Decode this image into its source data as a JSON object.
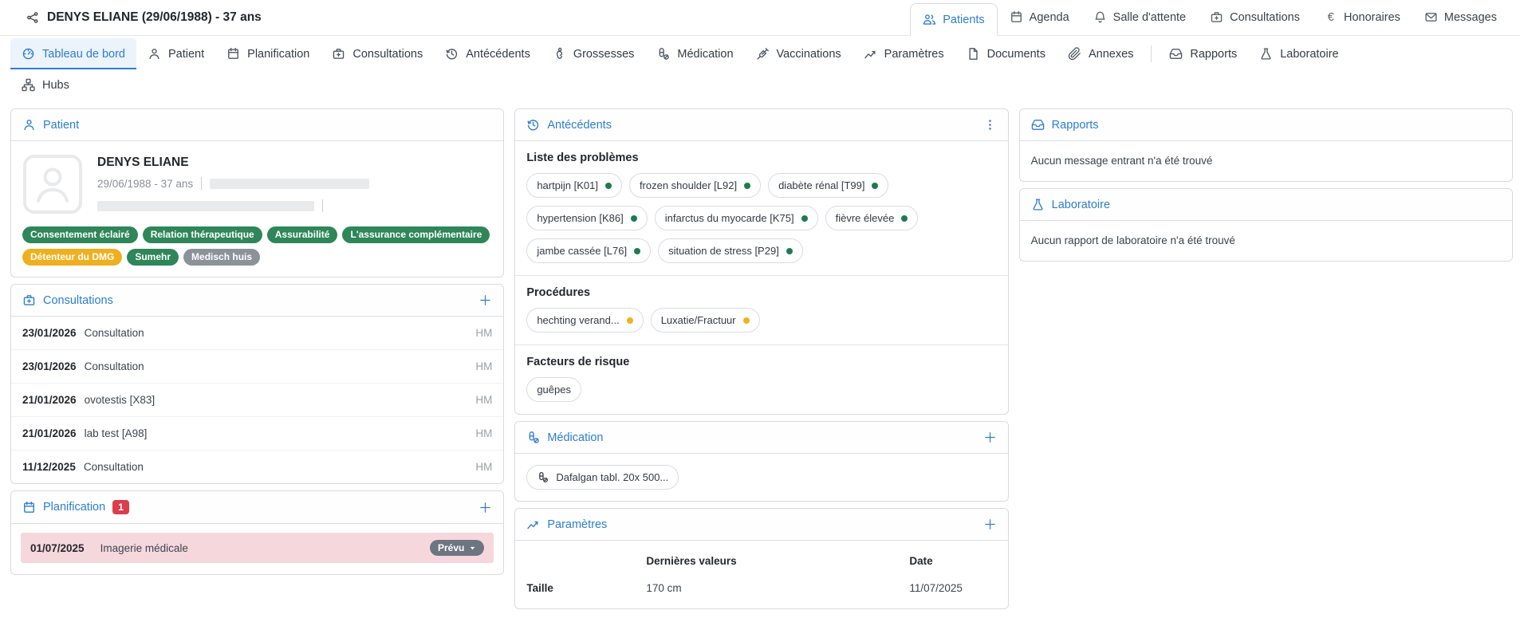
{
  "colors": {
    "accent_blue": "#2d7dd2",
    "badge_green": "#2e8659",
    "badge_yellow": "#efb020",
    "badge_gray": "#8b9299",
    "count_red": "#dc3d4c",
    "planned_row_pink": "#f6d8dc",
    "dot_green": "#1d7c4d",
    "dot_yellow": "#f3b11b"
  },
  "topbar": {
    "icon": "share-icon",
    "patient_summary": "DENYS ELIANE (29/06/1988) - 37 ans",
    "tabs": [
      {
        "label": "Patients",
        "icon": "patients-icon",
        "state": "active"
      },
      {
        "label": "Agenda",
        "icon": "agenda-icon"
      },
      {
        "label": "Salle d'attente",
        "icon": "waiting-room-icon"
      },
      {
        "label": "Consultations",
        "icon": "consultations-icon"
      },
      {
        "label": "Honoraires",
        "icon": "euro-icon"
      },
      {
        "label": "Messages",
        "icon": "messages-icon"
      }
    ]
  },
  "nav": {
    "row1": [
      {
        "label": "Tableau de bord",
        "icon": "dashboard-icon",
        "state": "active"
      },
      {
        "label": "Patient",
        "icon": "patient-icon"
      },
      {
        "label": "Planification",
        "icon": "planification-icon"
      },
      {
        "label": "Consultations",
        "icon": "consultations-icon"
      },
      {
        "label": "Antécédents",
        "icon": "history-icon"
      },
      {
        "label": "Grossesses",
        "icon": "pregnancy-icon"
      },
      {
        "label": "Médication",
        "icon": "medication-icon"
      },
      {
        "label": "Vaccinations",
        "icon": "vaccination-icon"
      },
      {
        "label": "Paramètres",
        "icon": "parameters-icon"
      },
      {
        "label": "Documents",
        "icon": "documents-icon"
      },
      {
        "label": "Annexes",
        "icon": "annexes-icon"
      }
    ],
    "row1_right": [
      {
        "label": "Rapports",
        "icon": "rapports-icon"
      },
      {
        "label": "Laboratoire",
        "icon": "laboratoire-icon"
      }
    ],
    "row2": [
      {
        "label": "Hubs",
        "icon": "hubs-icon"
      }
    ]
  },
  "patient_card": {
    "title": "Patient",
    "icon": "patient-icon",
    "avatar_icon": "avatar-placeholder-icon",
    "name": "DENYS ELIANE",
    "birth_age": "29/06/1988 - 37 ans",
    "badges": [
      {
        "label": "Consentement éclairé",
        "color": "green"
      },
      {
        "label": "Relation thérapeutique",
        "color": "green"
      },
      {
        "label": "Assurabilité",
        "color": "green"
      },
      {
        "label": "L'assurance complémentaire",
        "color": "green"
      },
      {
        "label": "Détenteur du DMG",
        "color": "yellow"
      },
      {
        "label": "Sumehr",
        "color": "green"
      },
      {
        "label": "Medisch huis",
        "color": "gray"
      }
    ]
  },
  "consultations_card": {
    "title": "Consultations",
    "icon": "consultations-icon",
    "rows": [
      {
        "date": "23/01/2026",
        "label": "Consultation",
        "tag": "HM"
      },
      {
        "date": "23/01/2026",
        "label": "Consultation",
        "tag": "HM"
      },
      {
        "date": "21/01/2026",
        "label": "ovotestis [X83]",
        "tag": "HM"
      },
      {
        "date": "21/01/2026",
        "label": "lab test [A98]",
        "tag": "HM"
      },
      {
        "date": "11/12/2025",
        "label": "Consultation",
        "tag": "HM"
      }
    ]
  },
  "planification_card": {
    "title": "Planification",
    "icon": "planification-icon",
    "count": "1",
    "rows": [
      {
        "date": "01/07/2025",
        "label": "Imagerie médicale",
        "status": "Prévu"
      }
    ]
  },
  "antecedents_card": {
    "title": "Antécédents",
    "icon": "history-icon",
    "sections": [
      {
        "heading": "Liste des problèmes",
        "chips": [
          {
            "label": "hartpijn [K01]",
            "dot": "green"
          },
          {
            "label": "frozen shoulder [L92]",
            "dot": "green"
          },
          {
            "label": "diabète rénal [T99]",
            "dot": "green"
          },
          {
            "label": "hypertension [K86]",
            "dot": "green"
          },
          {
            "label": "infarctus du myocarde [K75]",
            "dot": "green"
          },
          {
            "label": "fièvre élevée",
            "dot": "green"
          },
          {
            "label": "jambe cassée [L76]",
            "dot": "green"
          },
          {
            "label": "situation de stress [P29]",
            "dot": "green"
          }
        ]
      },
      {
        "heading": "Procédures",
        "chips": [
          {
            "label": "hechting verand...",
            "dot": "yellow"
          },
          {
            "label": "Luxatie/Fractuur",
            "dot": "yellow"
          }
        ]
      },
      {
        "heading": "Facteurs de risque",
        "chips": [
          {
            "label": "guêpes"
          }
        ]
      }
    ]
  },
  "medication_card": {
    "title": "Médication",
    "icon": "medication-icon",
    "chips": [
      {
        "label": "Dafalgan tabl. 20x 500...",
        "icon": "medication-icon"
      }
    ]
  },
  "parameters_card": {
    "title": "Paramètres",
    "icon": "parameters-icon",
    "columns": [
      "",
      "Dernières valeurs",
      "Date"
    ],
    "rows": [
      {
        "name": "Taille",
        "value": "170 cm",
        "date": "11/07/2025"
      }
    ]
  },
  "rapports_card": {
    "title": "Rapports",
    "icon": "rapports-icon",
    "empty_message": "Aucun message entrant n'a été trouvé"
  },
  "laboratoire_card": {
    "title": "Laboratoire",
    "icon": "laboratoire-icon",
    "empty_message": "Aucun rapport de laboratoire n'a été trouvé"
  }
}
